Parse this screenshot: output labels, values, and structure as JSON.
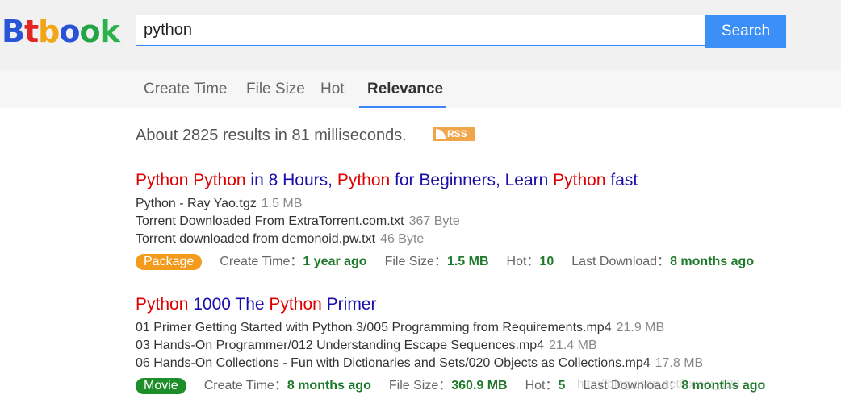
{
  "header": {
    "logo_letters": [
      {
        "ch": "B",
        "color": "#2956d6"
      },
      {
        "ch": "t",
        "color": "#e52424"
      },
      {
        "ch": "b",
        "color": "#f2a516"
      },
      {
        "ch": "o",
        "color": "#2a52d8"
      },
      {
        "ch": "o",
        "color": "#23a547"
      },
      {
        "ch": "k",
        "color": "#2bb24b"
      }
    ],
    "search_value": "python",
    "search_button": "Search"
  },
  "tabs": [
    {
      "label": "Create Time"
    },
    {
      "label": "File Size"
    },
    {
      "label": "Hot"
    },
    {
      "label": "Relevance",
      "active": true
    }
  ],
  "summary": {
    "text": "About 2825 results in 81 milliseconds.",
    "rss_label": "RSS"
  },
  "results": [
    {
      "title_parts": [
        {
          "text": "Python Python",
          "hl": true
        },
        {
          "text": " in 8 Hours, ",
          "hl": false
        },
        {
          "text": "Python",
          "hl": true
        },
        {
          "text": " for Beginners, Learn ",
          "hl": false
        },
        {
          "text": "Python",
          "hl": true
        },
        {
          "text": " fast",
          "hl": false
        }
      ],
      "files": [
        {
          "name": "Python - Ray Yao.tgz",
          "size": "1.5 MB"
        },
        {
          "name": "Torrent Downloaded From ExtraTorrent.com.txt",
          "size": "367 Byte"
        },
        {
          "name": "Torrent downloaded from demonoid.pw.txt",
          "size": "46 Byte"
        }
      ],
      "category": "Package",
      "category_type": "package",
      "meta": {
        "create_label": "Create Time：",
        "create_value": "1 year ago",
        "size_label": "File Size：",
        "size_value": "1.5 MB",
        "hot_label": "Hot：",
        "hot_value": "10",
        "last_label": "Last Download：",
        "last_value": "8 months ago"
      }
    },
    {
      "title_parts": [
        {
          "text": "Python",
          "hl": true
        },
        {
          "text": " 1000 The ",
          "hl": false
        },
        {
          "text": "Python",
          "hl": true
        },
        {
          "text": " Primer",
          "hl": false
        }
      ],
      "files": [
        {
          "name": "01 Primer Getting Started with Python 3/005 Programming from Requirements.mp4",
          "size": "21.9 MB"
        },
        {
          "name": "03 Hands-On Programmer/012 Understanding Escape Sequences.mp4",
          "size": "21.4 MB"
        },
        {
          "name": "06 Hands-On Collections - Fun with Dictionaries and Sets/020 Objects as Collections.mp4",
          "size": "17.8 MB"
        }
      ],
      "category": "Movie",
      "category_type": "movie",
      "meta": {
        "create_label": "Create Time：",
        "create_value": "8 months ago",
        "size_label": "File Size：",
        "size_value": "360.9 MB",
        "hot_label": "Hot：",
        "hot_value": "5",
        "last_label": "Last Download：",
        "last_value": "8 months ago"
      }
    }
  ],
  "watermark": "http://blog.csdn.net/xxxxx_123"
}
